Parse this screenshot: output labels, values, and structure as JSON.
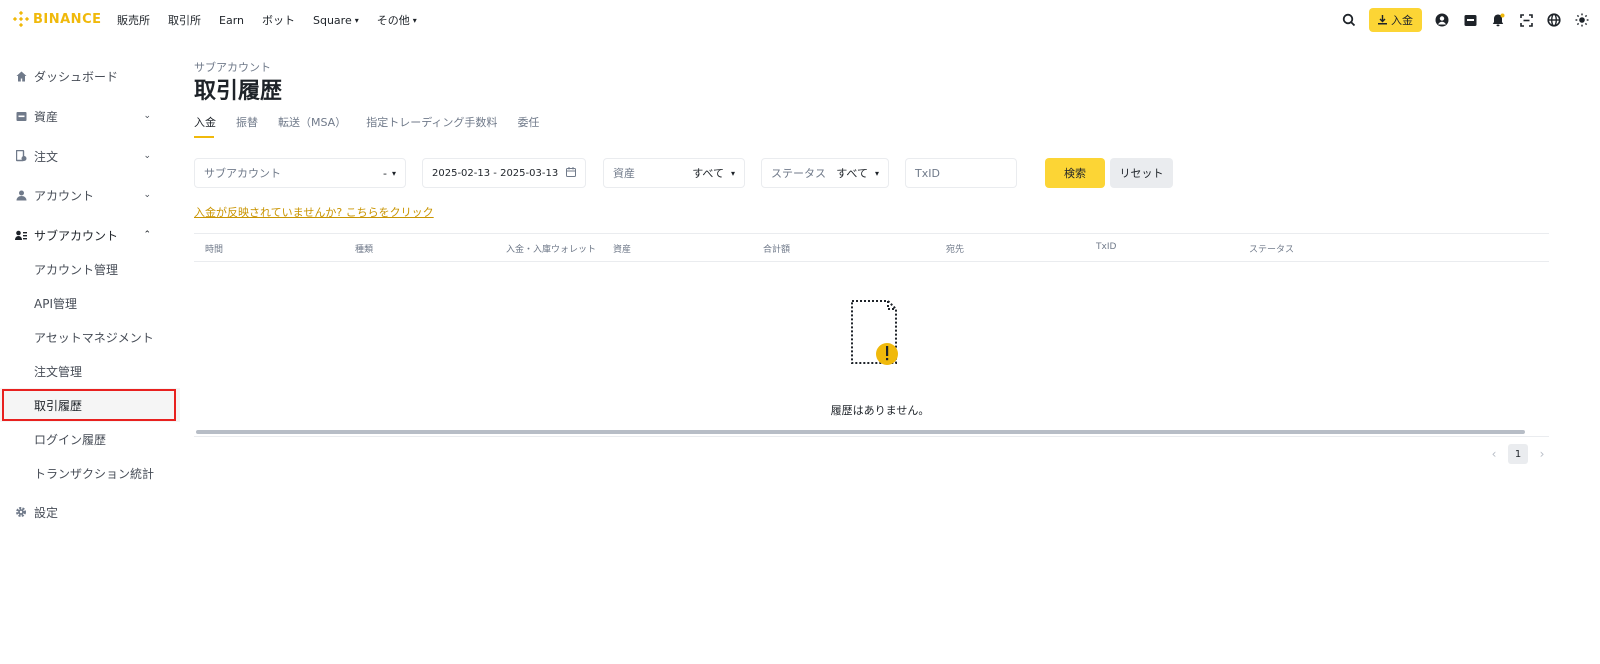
{
  "header": {
    "logo_text": "BINANCE",
    "nav": [
      {
        "label": "販売所",
        "dropdown": false
      },
      {
        "label": "取引所",
        "dropdown": false
      },
      {
        "label": "Earn",
        "dropdown": false
      },
      {
        "label": "ボット",
        "dropdown": false
      },
      {
        "label": "Square",
        "dropdown": true
      },
      {
        "label": "その他",
        "dropdown": true
      }
    ],
    "deposit_label": "入金",
    "icons": [
      "search-icon",
      "download-icon",
      "user-icon",
      "wallet-icon",
      "bell-icon",
      "qr-scan-icon",
      "globe-icon",
      "theme-icon"
    ],
    "accent_color": "#f0b90b",
    "button_color": "#fcd535"
  },
  "sidebar": {
    "items": [
      {
        "label": "ダッシュボード",
        "icon": "home-icon"
      },
      {
        "label": "資産",
        "icon": "wallet-icon",
        "caret": "down"
      },
      {
        "label": "注文",
        "icon": "order-icon",
        "caret": "down"
      },
      {
        "label": "アカウント",
        "icon": "user-icon",
        "caret": "down"
      },
      {
        "label": "サブアカウント",
        "icon": "sub-account-icon",
        "caret": "up"
      }
    ],
    "sub_items": [
      "アカウント管理",
      "API管理",
      "アセットマネジメント",
      "注文管理",
      "取引履歴",
      "ログイン履歴",
      "トランザクション統計"
    ],
    "settings": {
      "label": "設定",
      "icon": "gear-icon"
    }
  },
  "main": {
    "breadcrumb": "サブアカウント",
    "title": "取引履歴",
    "tabs": [
      "入金",
      "振替",
      "転送（MSA）",
      "指定トレーディング手数料",
      "委任"
    ],
    "filters": {
      "subaccount_placeholder": "サブアカウント",
      "subaccount_value": "-",
      "date_range": "2025-02-13 - 2025-03-13",
      "asset_label": "資産",
      "asset_value": "すべて",
      "status_label": "ステータス",
      "status_value": "すべて",
      "txid_placeholder": "TxID"
    },
    "search_button": "検索",
    "reset_button": "リセット",
    "notice_link": "入金が反映されていませんか? こちらをクリック",
    "table": {
      "columns": [
        "時間",
        "種類",
        "入金・入庫ウォレット",
        "資産",
        "合計額",
        "宛先",
        "TxID",
        "ステータス"
      ],
      "rows": []
    },
    "empty_text": "履歴はありません。",
    "pagination": {
      "current_page": "1"
    }
  }
}
